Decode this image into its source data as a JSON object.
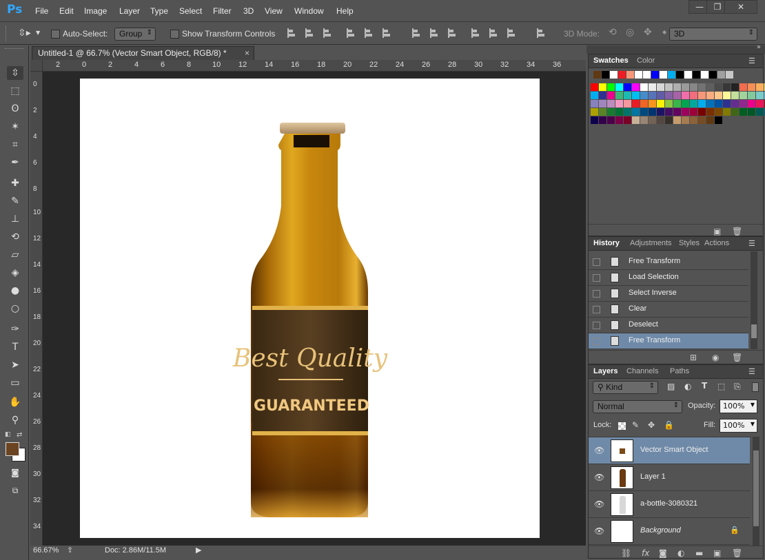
{
  "app": {
    "logo": "Ps"
  },
  "menu": [
    "File",
    "Edit",
    "Image",
    "Layer",
    "Type",
    "Select",
    "Filter",
    "3D",
    "View",
    "Window",
    "Help"
  ],
  "window_controls": {
    "minimize": "—",
    "restore": "❐",
    "close": "✕"
  },
  "options_bar": {
    "auto_select_label": "Auto-Select:",
    "auto_select_value": "Group",
    "show_transform_label": "Show Transform Controls",
    "mode_3d_label": "3D Mode:",
    "mode_3d_value": "3D"
  },
  "document": {
    "tab_title": "Untitled-1 @ 66.7% (Vector Smart Object, RGB/8) *",
    "tab_close": "×",
    "ruler_top": [
      "2",
      "0",
      "2",
      "4",
      "6",
      "8",
      "10",
      "12",
      "14",
      "16",
      "18",
      "20",
      "22",
      "24",
      "26",
      "28",
      "30",
      "32",
      "34",
      "36"
    ],
    "ruler_left": [
      "0",
      "2",
      "4",
      "6",
      "8",
      "10",
      "12",
      "14",
      "16",
      "18",
      "20",
      "22",
      "24",
      "26",
      "28",
      "30",
      "32",
      "34"
    ],
    "zoom": "66.67%",
    "doc_size": "Doc: 2.86M/11.5M",
    "label_line1": "Best Quality",
    "label_line2": "GUARANTEED"
  },
  "swatches_panel": {
    "tabs": [
      "Swatches",
      "Color"
    ],
    "top_row": [
      "#603813",
      "#000000",
      "#ffffff",
      "#ed1c24",
      "#f7977a",
      "#ffffff",
      "#ffffff",
      "#0000ff",
      "#ffffff",
      "#00aeef",
      "#000000",
      "#ffffff",
      "#000000",
      "#ffffff",
      "#000000",
      "#a0a0a0",
      "#c8c8c8"
    ],
    "rows": [
      [
        "#ff0000",
        "#ffff00",
        "#00ff00",
        "#00ffff",
        "#0000ff",
        "#ff00ff",
        "#ffffff",
        "#ebebeb",
        "#d7d7d7",
        "#c3c3c3",
        "#afafaf",
        "#9b9b9b",
        "#878787",
        "#737373",
        "#5f5f5f",
        "#4b4b4b",
        "#373737",
        "#232323",
        "#f26c4f",
        "#f68e56",
        "#fbaf5d",
        "#fff568",
        "#acd372",
        "#7cc576"
      ],
      [
        "#00aeef",
        "#2e3192",
        "#ec008c",
        "#3cb878",
        "#1cbbb4",
        "#00bff3",
        "#448ccb",
        "#5674b9",
        "#605ca8",
        "#8560a8",
        "#a763a8",
        "#f06eaa",
        "#f26d7d",
        "#f7977a",
        "#f9ad81",
        "#fdc68a",
        "#fff799",
        "#c4df9b",
        "#a3d39c",
        "#82ca9c",
        "#7accc8",
        "#6dcff6",
        "#7da7d9",
        "#8393ca"
      ],
      [
        "#8781bd",
        "#a186be",
        "#bd8cbf",
        "#f49ac2",
        "#f6989d",
        "#ed1c24",
        "#f26522",
        "#f7941d",
        "#fff200",
        "#8dc63f",
        "#39b54a",
        "#00a651",
        "#00a99d",
        "#00aeef",
        "#0072bc",
        "#0054a6",
        "#2e3192",
        "#662d91",
        "#92278f",
        "#ec008c",
        "#ed145b",
        "#9e0b0f",
        "#a0410d",
        "#a36209"
      ],
      [
        "#aba000",
        "#598527",
        "#197b30",
        "#007236",
        "#00746b",
        "#0076a3",
        "#004a80",
        "#003471",
        "#1b1464",
        "#440e62",
        "#630460",
        "#9e005d",
        "#9e0039",
        "#790000",
        "#7b2e00",
        "#7d4900",
        "#827b00",
        "#406618",
        "#005e20",
        "#005826",
        "#005952",
        "#005b7f",
        "#003663",
        "#002157"
      ],
      [
        "#0d004c",
        "#32004b",
        "#4b0049",
        "#7b0046",
        "#7a0026",
        "#c7b299",
        "#998675",
        "#736357",
        "#534741",
        "#37302a",
        "#c69c6d",
        "#a67c52",
        "#8c6239",
        "#754c24",
        "#603913",
        "#000000"
      ]
    ]
  },
  "history_panel": {
    "tabs": [
      "History",
      "Adjustments",
      "Styles",
      "Actions"
    ],
    "items": [
      "Free Transform",
      "Load Selection",
      "Select Inverse",
      "Clear",
      "Deselect",
      "Free Transform"
    ],
    "selected_index": 5
  },
  "layers_panel": {
    "tabs": [
      "Layers",
      "Channels",
      "Paths"
    ],
    "kind_label": "Kind",
    "blend_mode": "Normal",
    "opacity_label": "Opacity:",
    "opacity_value": "100%",
    "lock_label": "Lock:",
    "fill_label": "Fill:",
    "fill_value": "100%",
    "layers": [
      "Vector Smart Object",
      "Layer 1",
      "a-bottle-3080321",
      "Background"
    ],
    "selected_index": 0
  },
  "colors": {
    "foreground": "#6b4421",
    "background": "#ffffff",
    "selection": "#6f8aa8"
  }
}
